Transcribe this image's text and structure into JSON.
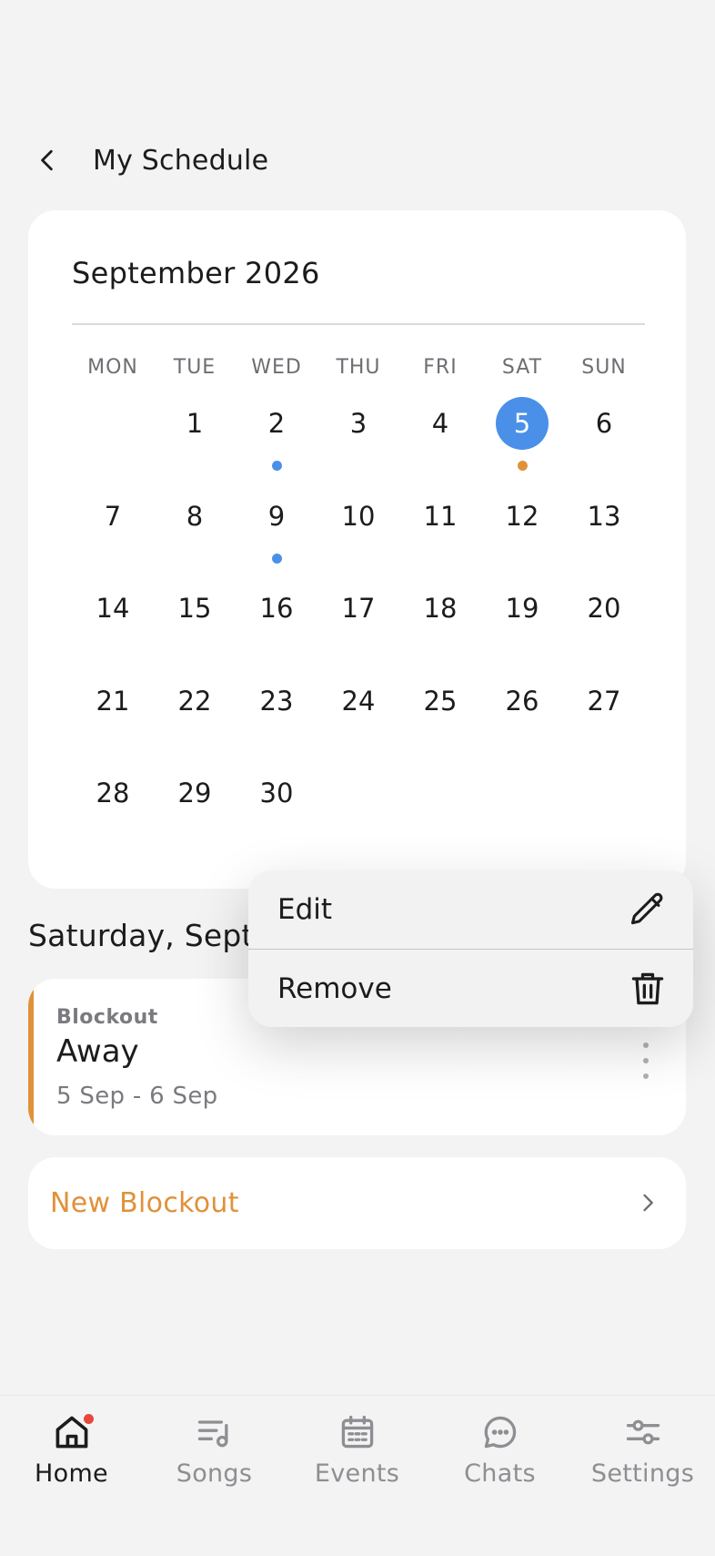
{
  "header": {
    "title": "My Schedule"
  },
  "calendar": {
    "month": "September 2026",
    "weekdays": [
      "MON",
      "TUE",
      "WED",
      "THU",
      "FRI",
      "SAT",
      "SUN"
    ],
    "leading_blanks": 1,
    "days_in_month": 30,
    "selected_day": 5,
    "dots": [
      {
        "day": 2,
        "color": "#4a90e8"
      },
      {
        "day": 9,
        "color": "#4a90e8"
      },
      {
        "day": 5,
        "color": "#e0913a"
      }
    ]
  },
  "selected_date_heading": "Saturday, Septe",
  "blockout": {
    "type": "Blockout",
    "title": "Away",
    "range": "5 Sep - 6 Sep"
  },
  "new_blockout": {
    "label": "New Blockout"
  },
  "context_menu": {
    "edit_label": "Edit",
    "remove_label": "Remove"
  },
  "nav": {
    "home": "Home",
    "songs": "Songs",
    "events": "Events",
    "chats": "Chats",
    "settings": "Settings"
  },
  "colors": {
    "accent_blue": "#4a90e8",
    "accent_orange": "#e0913a",
    "badge_red": "#e5483d"
  }
}
